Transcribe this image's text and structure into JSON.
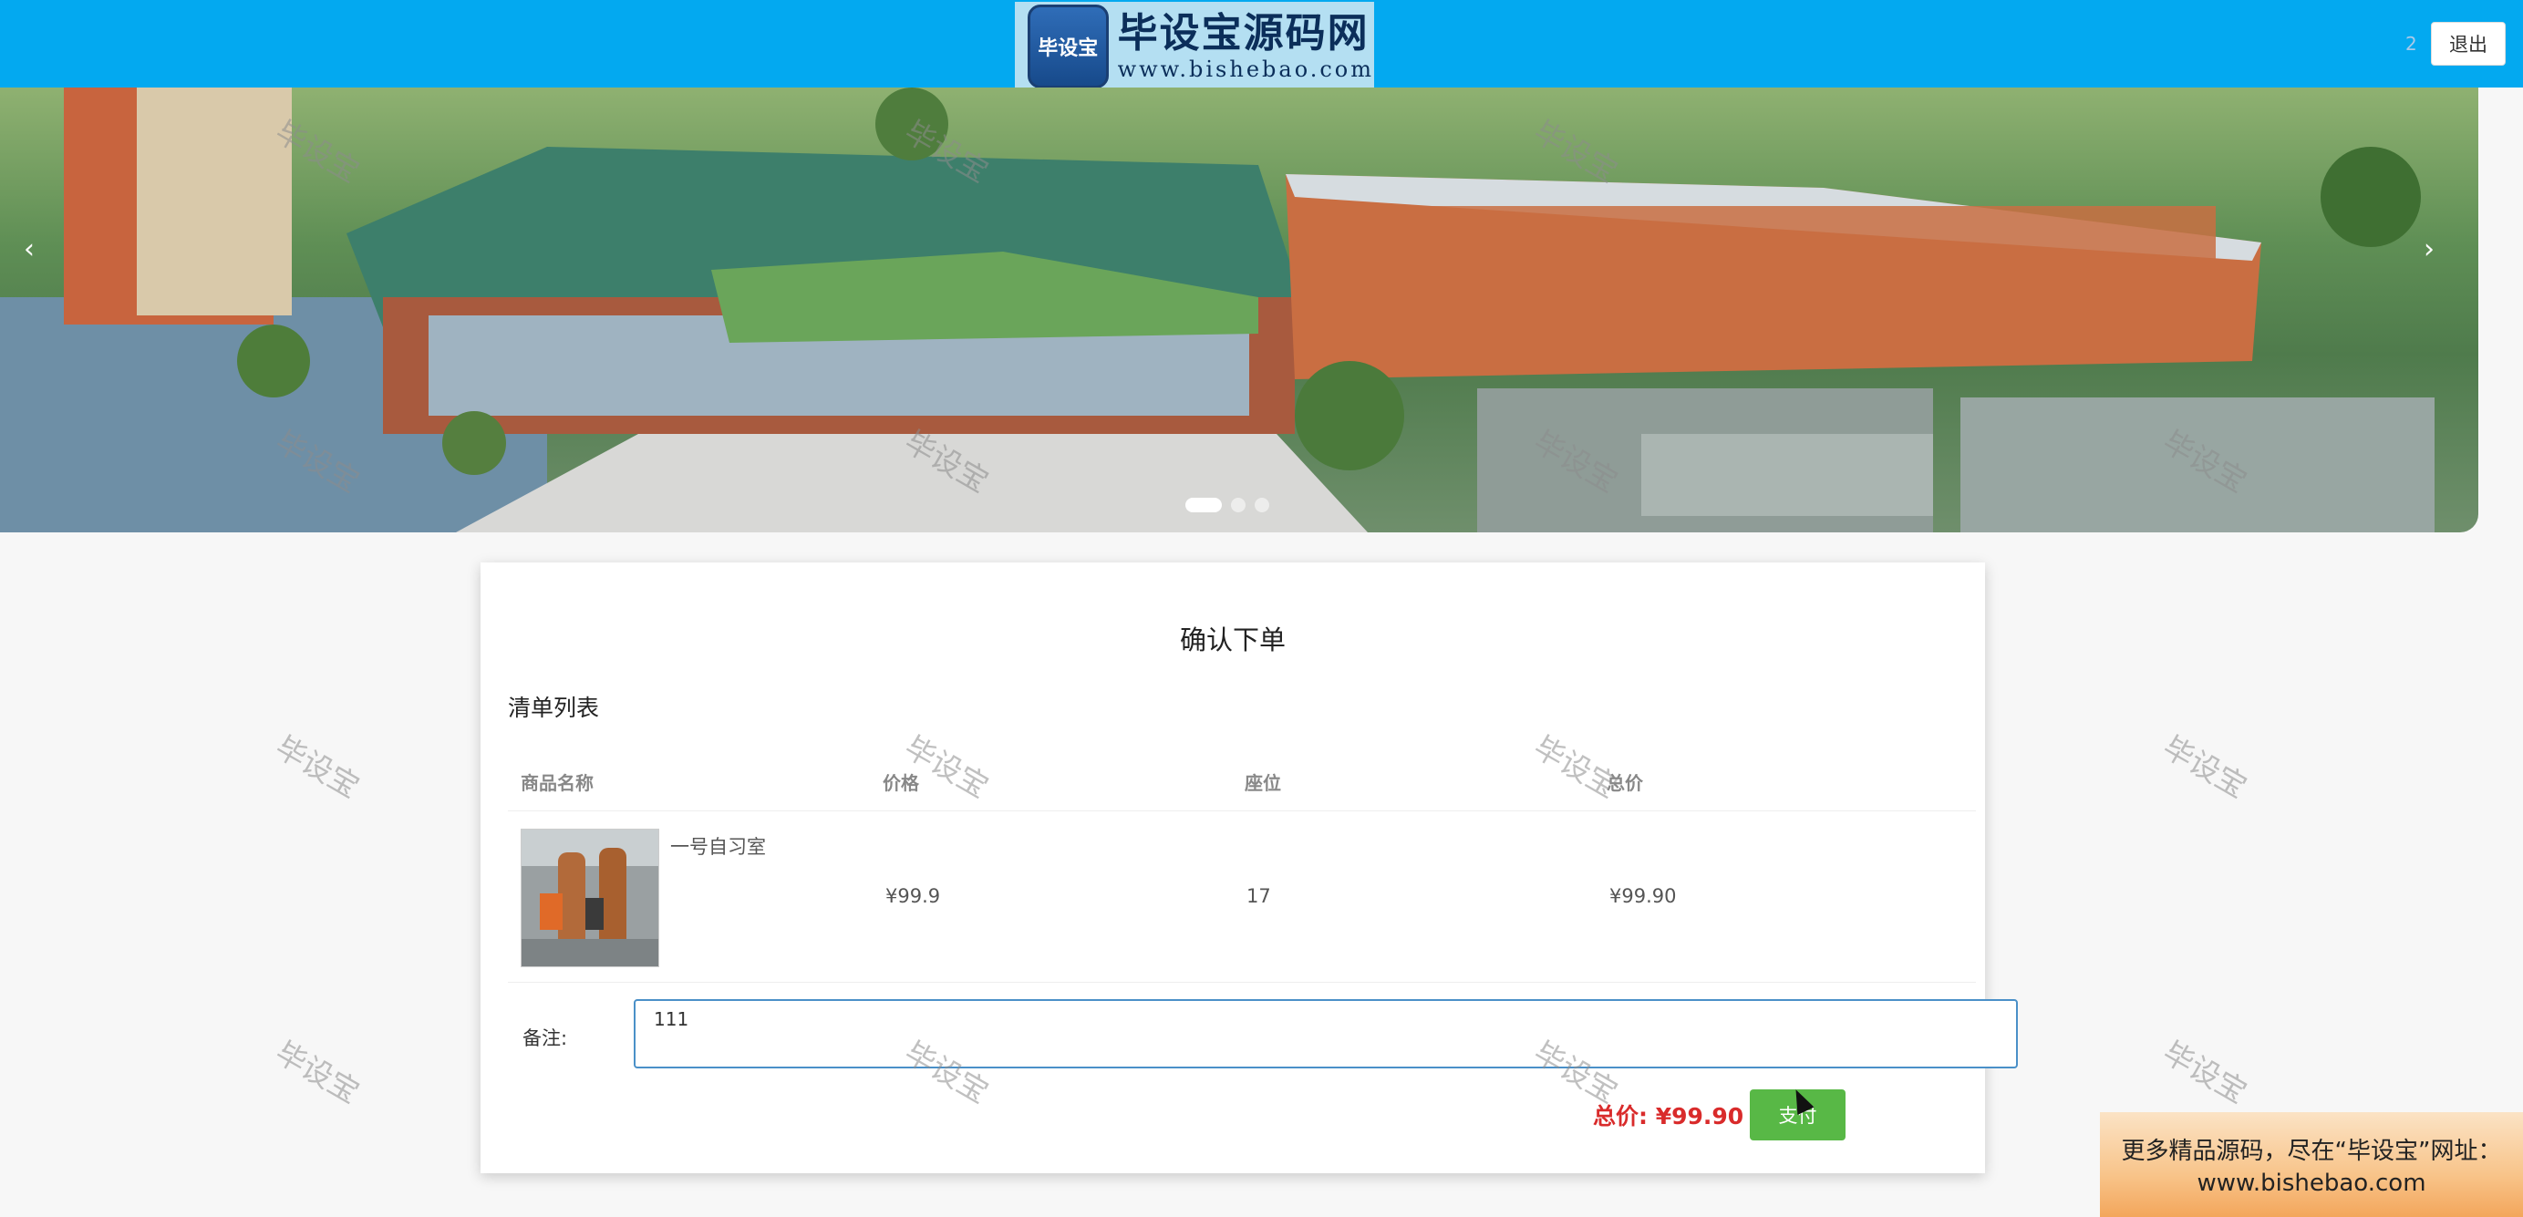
{
  "header": {
    "logo_badge": "毕设宝",
    "logo_title": "毕设宝源码网",
    "logo_url": "www.bishebao.com",
    "user_name": "2",
    "logout_label": "退出"
  },
  "banner": {
    "prev_icon": "‹",
    "next_icon": "›",
    "slides": 3,
    "active_slide": 1
  },
  "order": {
    "page_title": "确认下单",
    "list_title": "清单列表",
    "columns": [
      "商品名称",
      "价格",
      "座位",
      "总价"
    ],
    "items": [
      {
        "name": "一号自习室",
        "price": "¥99.9",
        "seat": "17",
        "total": "¥99.90"
      }
    ],
    "remark_label": "备注:",
    "remark_value": "111",
    "total_label": "总价: ¥99.90",
    "pay_label": "支付"
  },
  "watermark_text": "毕设宝",
  "ad": {
    "line1": "更多精品源码，尽在“毕设宝”网址：",
    "line2": "www.bishebao.com"
  }
}
